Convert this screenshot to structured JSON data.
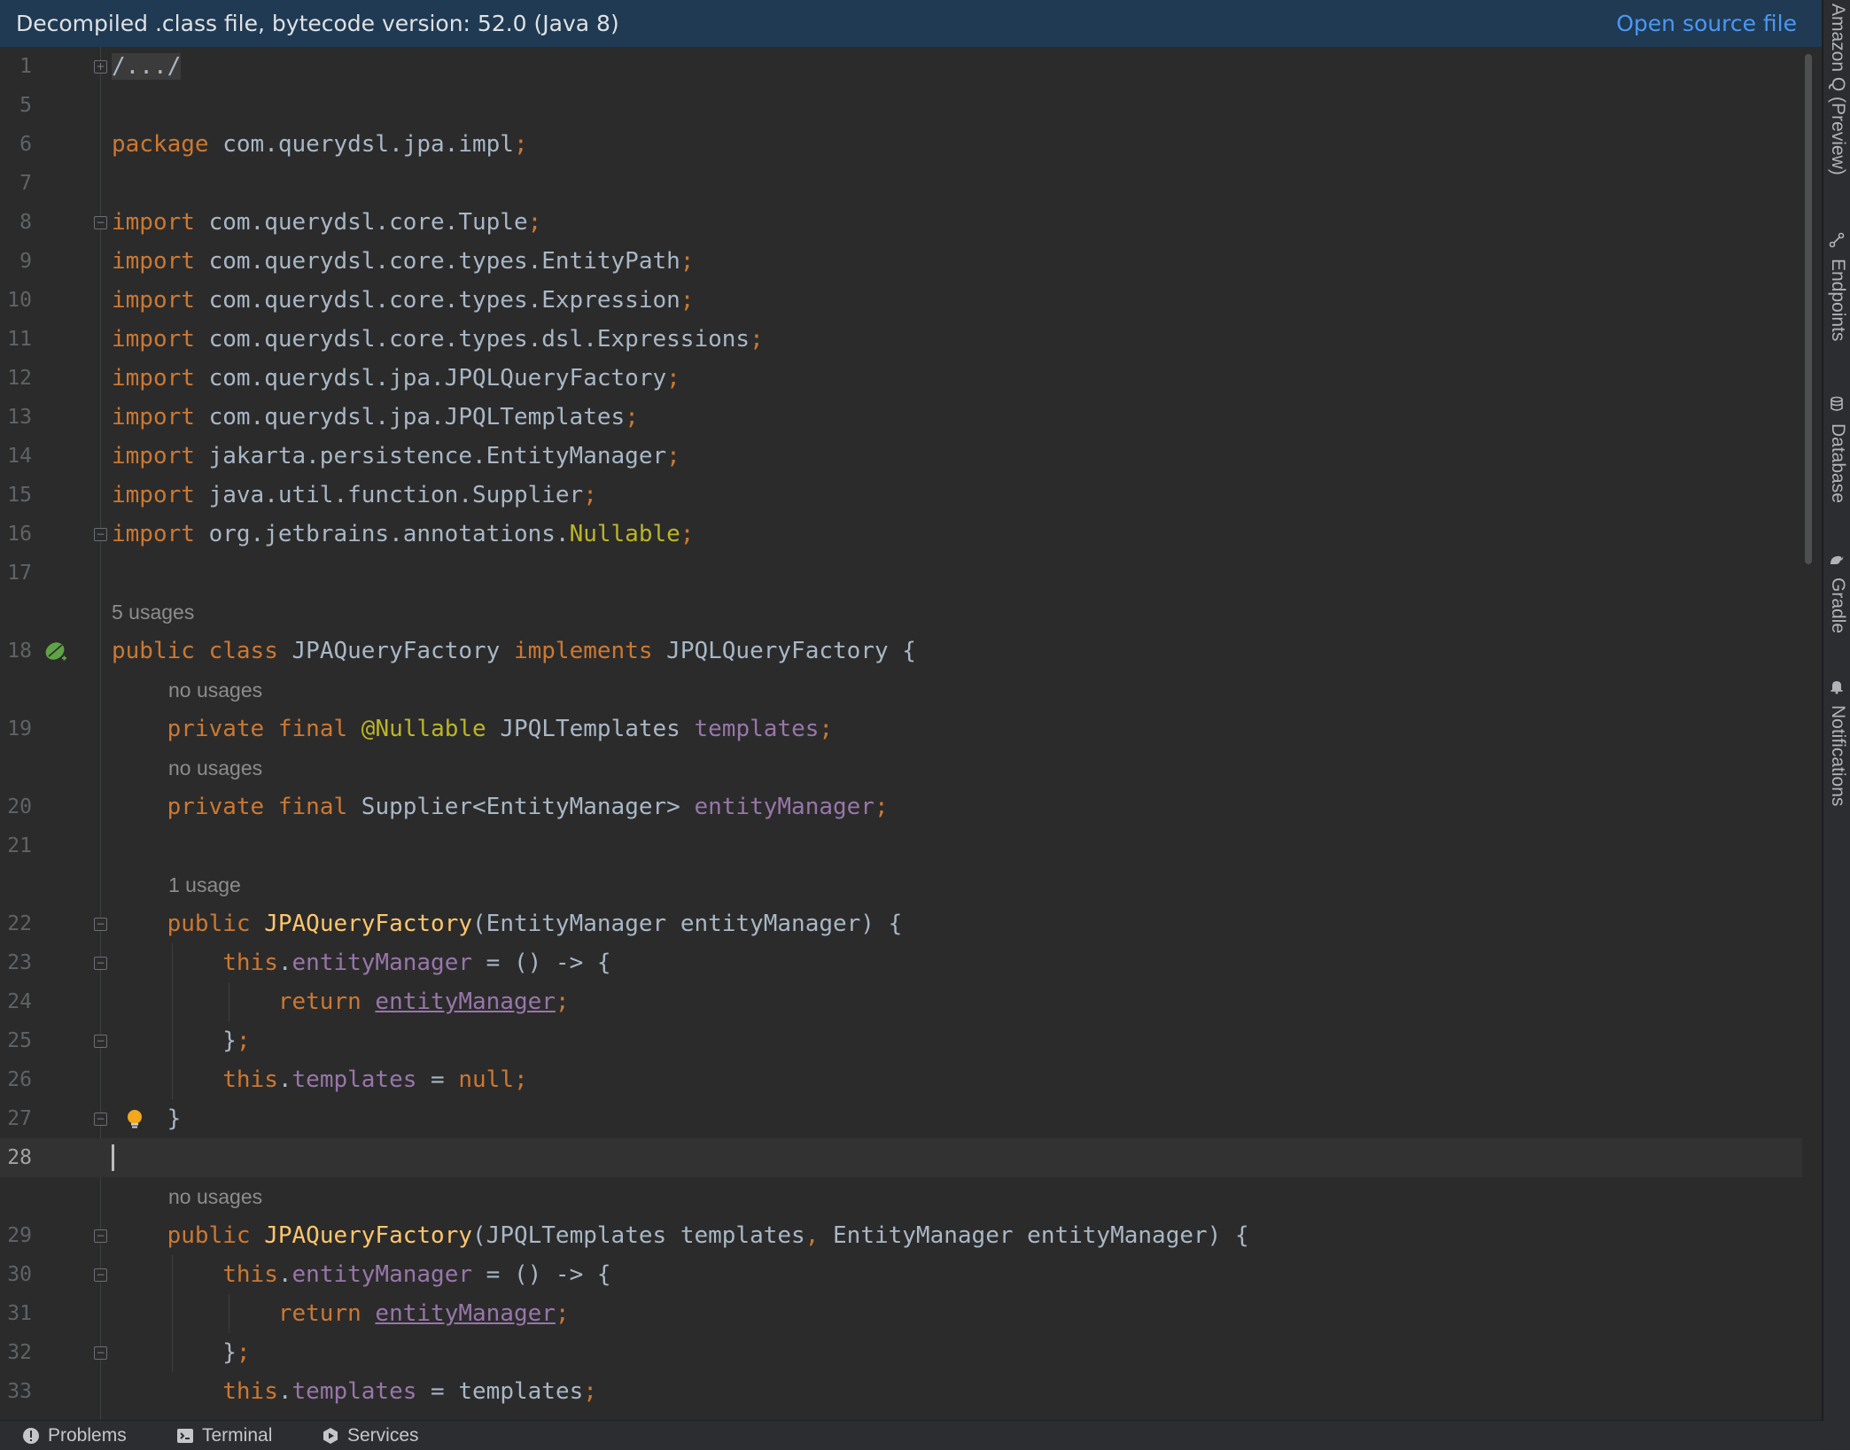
{
  "banner": {
    "message": "Decompiled .class file, bytecode version: 52.0 (Java 8)",
    "action": "Open source file"
  },
  "editor": {
    "current_line": "28",
    "lines": [
      {
        "n": "1",
        "code": "/.../"
      },
      {
        "n": "5",
        "code": ""
      },
      {
        "n": "6",
        "code": "package com.querydsl.jpa.impl;"
      },
      {
        "n": "7",
        "code": ""
      },
      {
        "n": "8",
        "code": "import com.querydsl.core.Tuple;"
      },
      {
        "n": "9",
        "code": "import com.querydsl.core.types.EntityPath;"
      },
      {
        "n": "10",
        "code": "import com.querydsl.core.types.Expression;"
      },
      {
        "n": "11",
        "code": "import com.querydsl.core.types.dsl.Expressions;"
      },
      {
        "n": "12",
        "code": "import com.querydsl.jpa.JPQLQueryFactory;"
      },
      {
        "n": "13",
        "code": "import com.querydsl.jpa.JPQLTemplates;"
      },
      {
        "n": "14",
        "code": "import jakarta.persistence.EntityManager;"
      },
      {
        "n": "15",
        "code": "import java.util.function.Supplier;"
      },
      {
        "n": "16",
        "code": "import org.jetbrains.annotations.Nullable;"
      },
      {
        "n": "17",
        "code": ""
      },
      {
        "n": "18",
        "code": "public class JPAQueryFactory implements JPQLQueryFactory {"
      },
      {
        "n": "19",
        "code": "    private final @Nullable JPQLTemplates templates;"
      },
      {
        "n": "20",
        "code": "    private final Supplier<EntityManager> entityManager;"
      },
      {
        "n": "21",
        "code": ""
      },
      {
        "n": "22",
        "code": "    public JPAQueryFactory(EntityManager entityManager) {"
      },
      {
        "n": "23",
        "code": "        this.entityManager = () -> {"
      },
      {
        "n": "24",
        "code": "            return entityManager;"
      },
      {
        "n": "25",
        "code": "        };"
      },
      {
        "n": "26",
        "code": "        this.templates = null;"
      },
      {
        "n": "27",
        "code": "    }"
      },
      {
        "n": "28",
        "code": ""
      },
      {
        "n": "29",
        "code": "    public JPAQueryFactory(JPQLTemplates templates, EntityManager entityManager) {"
      },
      {
        "n": "30",
        "code": "        this.entityManager = () -> {"
      },
      {
        "n": "31",
        "code": "            return entityManager;"
      },
      {
        "n": "32",
        "code": "        };"
      },
      {
        "n": "33",
        "code": "        this.templates = templates;"
      }
    ],
    "usage_hints": [
      {
        "before_line": "18",
        "text": "5 usages"
      },
      {
        "before_line": "19",
        "text": "no usages"
      },
      {
        "before_line": "20",
        "text": "no usages"
      },
      {
        "before_line": "22",
        "text": "1 usage"
      },
      {
        "before_line": "29",
        "text": "no usages"
      }
    ]
  },
  "right_tool_windows": [
    "Amazon Q (Preview)",
    "Endpoints",
    "Database",
    "Gradle",
    "Notifications"
  ],
  "status_bar": {
    "items": [
      {
        "label": "Problems",
        "icon": "problems-icon"
      },
      {
        "label": "Terminal",
        "icon": "terminal-icon"
      },
      {
        "label": "Services",
        "icon": "services-icon"
      }
    ]
  },
  "colors": {
    "keyword": "#cc7832",
    "field": "#9876aa",
    "annotation": "#bbb529",
    "method": "#ffc66d",
    "text": "#a9b7c6",
    "banner_bg": "#1f3a52",
    "link": "#4a98f5"
  }
}
